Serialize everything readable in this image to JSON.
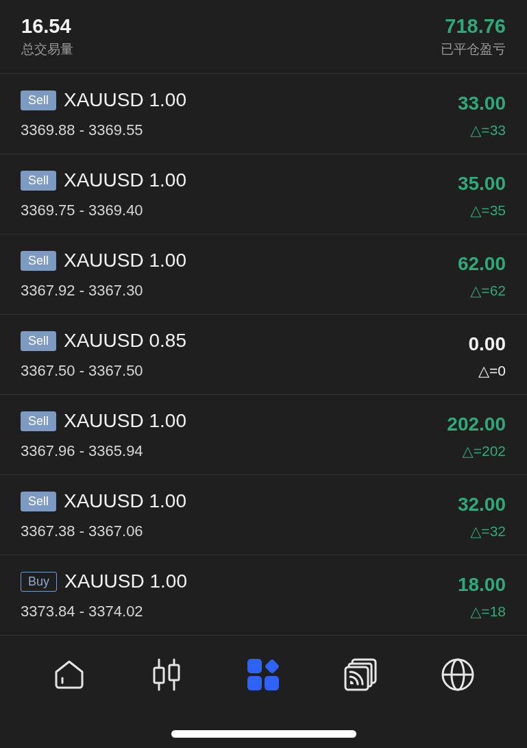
{
  "summary": {
    "total_volume": {
      "value": "16.54",
      "label": "总交易量"
    },
    "closed_pnl": {
      "value": "718.76",
      "label": "已平仓盈亏"
    }
  },
  "trades": [
    {
      "kind": "sell",
      "side": "Sell",
      "symbol": "XAUUSD 1.00",
      "prices": "3369.88 - 3369.55",
      "profit": "33.00",
      "delta": "△=33",
      "color": "#2ea97a"
    },
    {
      "kind": "sell",
      "side": "Sell",
      "symbol": "XAUUSD 1.00",
      "prices": "3369.75 - 3369.40",
      "profit": "35.00",
      "delta": "△=35",
      "color": "#2ea97a"
    },
    {
      "kind": "sell",
      "side": "Sell",
      "symbol": "XAUUSD 1.00",
      "prices": "3367.92 - 3367.30",
      "profit": "62.00",
      "delta": "△=62",
      "color": "#2ea97a"
    },
    {
      "kind": "sell",
      "side": "Sell",
      "symbol": "XAUUSD 0.85",
      "prices": "3367.50 - 3367.50",
      "profit": "0.00",
      "delta": "△=0",
      "color": "#f2f2f2"
    },
    {
      "kind": "sell",
      "side": "Sell",
      "symbol": "XAUUSD 1.00",
      "prices": "3367.96 - 3365.94",
      "profit": "202.00",
      "delta": "△=202",
      "color": "#2ea97a"
    },
    {
      "kind": "sell",
      "side": "Sell",
      "symbol": "XAUUSD 1.00",
      "prices": "3367.38 - 3367.06",
      "profit": "32.00",
      "delta": "△=32",
      "color": "#2ea97a"
    },
    {
      "kind": "buy",
      "side": "Buy",
      "symbol": "XAUUSD 1.00",
      "prices": "3373.84 - 3374.02",
      "profit": "18.00",
      "delta": "△=18",
      "color": "#2ea97a"
    }
  ],
  "tab_bar": {
    "tabs": [
      {
        "kind": "home",
        "selected": false
      },
      {
        "kind": "chart",
        "selected": false
      },
      {
        "kind": "apps",
        "selected": true
      },
      {
        "kind": "feed",
        "selected": false
      },
      {
        "kind": "globe",
        "selected": false
      }
    ]
  }
}
